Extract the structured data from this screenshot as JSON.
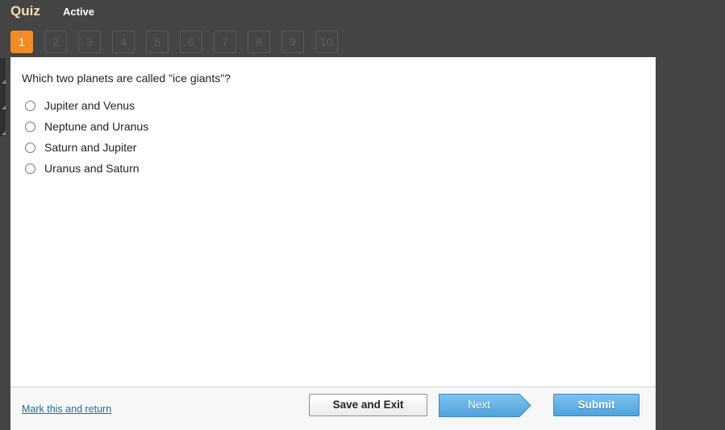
{
  "header": {
    "title": "Quiz",
    "status": "Active"
  },
  "question_nav": {
    "current": 1,
    "items": [
      "1",
      "2",
      "3",
      "4",
      "5",
      "6",
      "7",
      "8",
      "9",
      "10"
    ]
  },
  "question": {
    "text": "Which two planets are called \"ice giants\"?",
    "options": [
      {
        "label": "Jupiter and Venus",
        "selected": false
      },
      {
        "label": "Neptune and Uranus",
        "selected": false
      },
      {
        "label": "Saturn and Jupiter",
        "selected": false
      },
      {
        "label": "Uranus and Saturn",
        "selected": false
      }
    ]
  },
  "footer": {
    "mark_link": "Mark this and return",
    "save_exit": "Save and Exit",
    "next": "Next",
    "submit": "Submit"
  },
  "colors": {
    "accent_orange": "#f28c28",
    "button_blue": "#5aaee3",
    "link": "#1a6fa0",
    "background": "#454545"
  }
}
